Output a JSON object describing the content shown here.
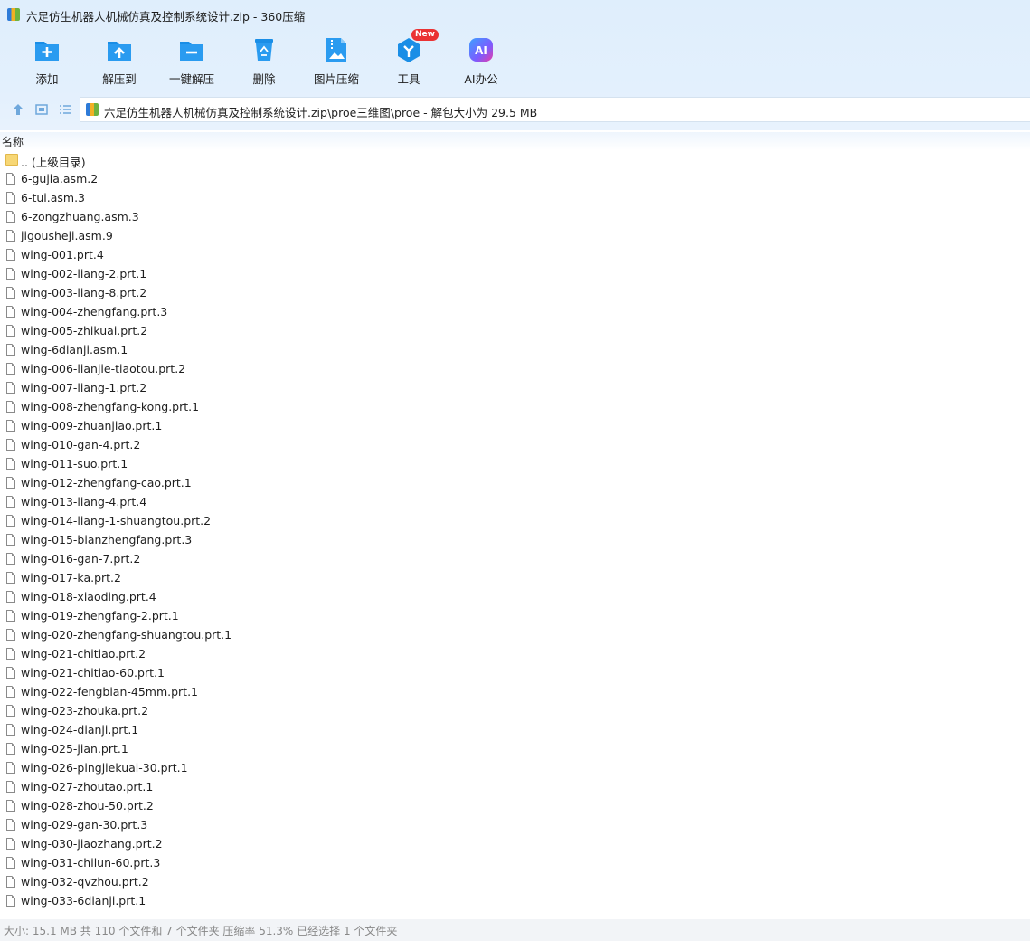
{
  "window": {
    "title": "六足仿生机器人机械仿真及控制系统设计.zip - 360压缩"
  },
  "toolbar": {
    "buttons": [
      {
        "label": "添加",
        "icon": "add-folder-icon"
      },
      {
        "label": "解压到",
        "icon": "extract-to-icon"
      },
      {
        "label": "一键解压",
        "icon": "one-click-extract-icon"
      },
      {
        "label": "删除",
        "icon": "recycle-bin-icon"
      },
      {
        "label": "图片压缩",
        "icon": "image-compress-icon"
      },
      {
        "label": "工具",
        "icon": "tools-icon",
        "badge": "New"
      },
      {
        "label": "AI办公",
        "icon": "ai-office-icon",
        "icon_text": "AI"
      }
    ]
  },
  "address": {
    "path": "六足仿生机器人机械仿真及控制系统设计.zip\\proe三维图\\proe - 解包大小为 29.5 MB"
  },
  "list": {
    "column_name": "名称",
    "parent_dir": ".. (上级目录)",
    "files": [
      "6-gujia.asm.2",
      "6-tui.asm.3",
      "6-zongzhuang.asm.3",
      "jigousheji.asm.9",
      "wing-001.prt.4",
      "wing-002-liang-2.prt.1",
      "wing-003-liang-8.prt.2",
      "wing-004-zhengfang.prt.3",
      "wing-005-zhikuai.prt.2",
      "wing-6dianji.asm.1",
      "wing-006-lianjie-tiaotou.prt.2",
      "wing-007-liang-1.prt.2",
      "wing-008-zhengfang-kong.prt.1",
      "wing-009-zhuanjiao.prt.1",
      "wing-010-gan-4.prt.2",
      "wing-011-suo.prt.1",
      "wing-012-zhengfang-cao.prt.1",
      "wing-013-liang-4.prt.4",
      "wing-014-liang-1-shuangtou.prt.2",
      "wing-015-bianzhengfang.prt.3",
      "wing-016-gan-7.prt.2",
      "wing-017-ka.prt.2",
      "wing-018-xiaoding.prt.4",
      "wing-019-zhengfang-2.prt.1",
      "wing-020-zhengfang-shuangtou.prt.1",
      "wing-021-chitiao.prt.2",
      "wing-021-chitiao-60.prt.1",
      "wing-022-fengbian-45mm.prt.1",
      "wing-023-zhouka.prt.2",
      "wing-024-dianji.prt.1",
      "wing-025-jian.prt.1",
      "wing-026-pingjiekuai-30.prt.1",
      "wing-027-zhoutao.prt.1",
      "wing-028-zhou-50.prt.2",
      "wing-029-gan-30.prt.3",
      "wing-030-jiaozhang.prt.2",
      "wing-031-chilun-60.prt.3",
      "wing-032-qvzhou.prt.2",
      "wing-033-6dianji.prt.1"
    ]
  },
  "status": {
    "text": "大小: 15.1 MB 共 110 个文件和 7 个文件夹 压缩率 51.3% 已经选择 1 个文件夹"
  },
  "colors": {
    "accent": "#1a8ee6",
    "toolbar_bg": "#e3f0fd",
    "badge": "#ea3233"
  }
}
